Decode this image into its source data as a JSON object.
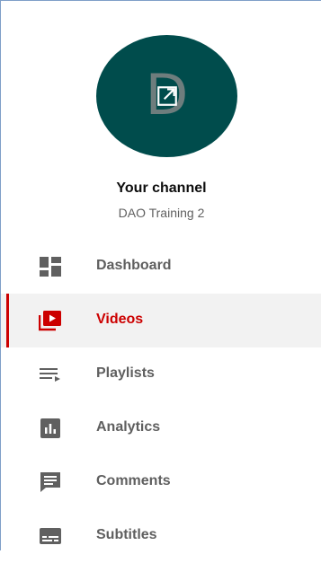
{
  "channel": {
    "avatar_letter": "D",
    "title": "Your channel",
    "name": "DAO Training 2"
  },
  "colors": {
    "avatar_bg": "#004c4c",
    "active_accent": "#cc0000",
    "icon_gray": "#606060",
    "active_bg": "#f2f2f2"
  },
  "nav": {
    "items": [
      {
        "label": "Dashboard",
        "icon": "dashboard-icon",
        "active": false
      },
      {
        "label": "Videos",
        "icon": "videos-icon",
        "active": true
      },
      {
        "label": "Playlists",
        "icon": "playlists-icon",
        "active": false
      },
      {
        "label": "Analytics",
        "icon": "analytics-icon",
        "active": false
      },
      {
        "label": "Comments",
        "icon": "comments-icon",
        "active": false
      },
      {
        "label": "Subtitles",
        "icon": "subtitles-icon",
        "active": false
      }
    ]
  }
}
